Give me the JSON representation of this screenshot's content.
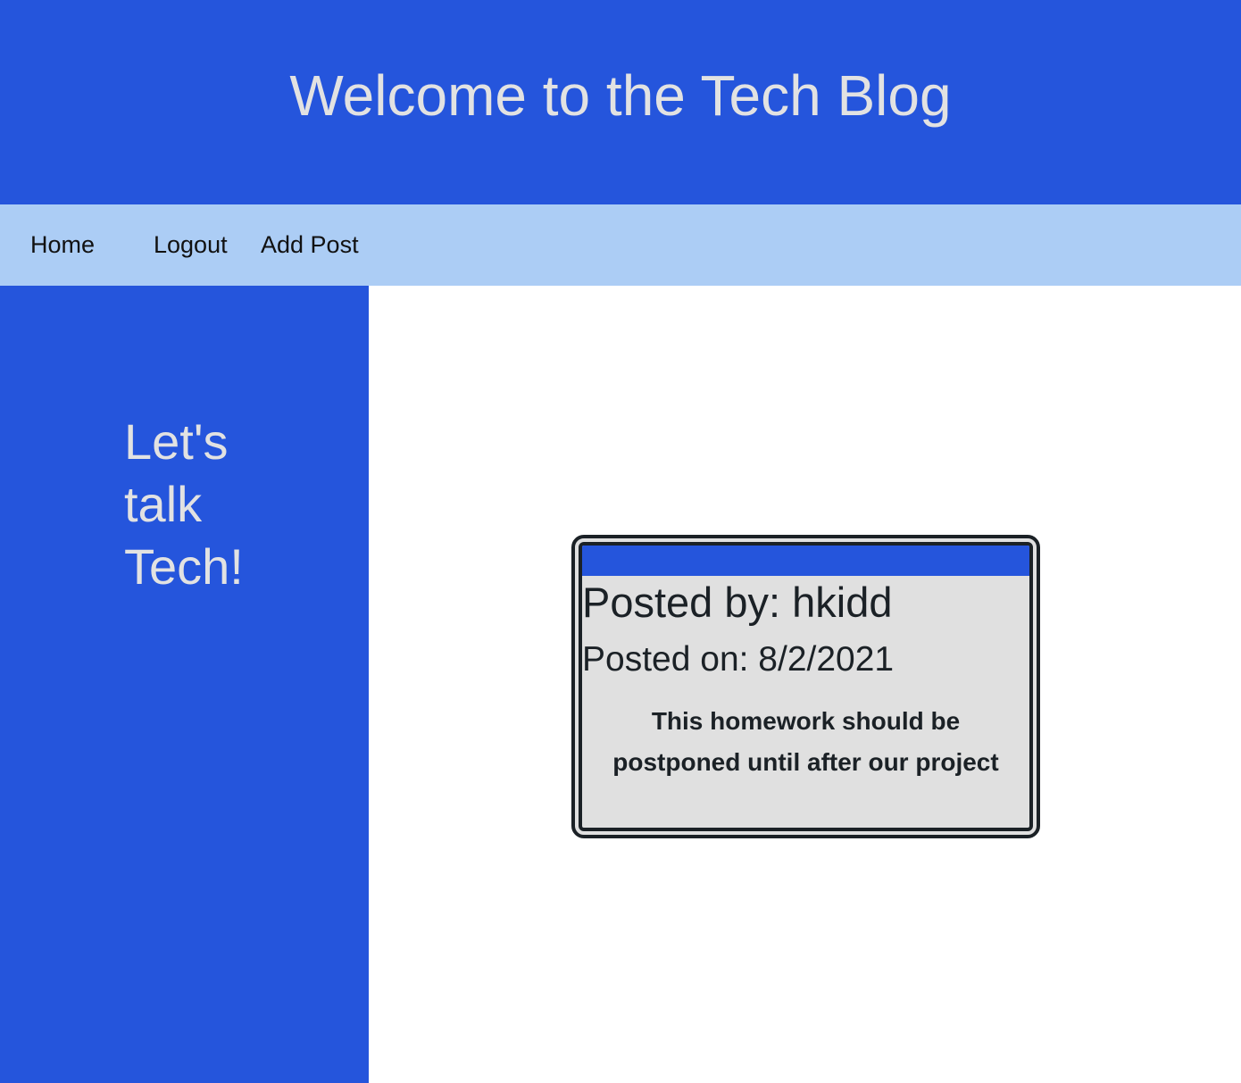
{
  "header": {
    "title": "Welcome to the Tech Blog"
  },
  "nav": {
    "items": [
      {
        "label": "Home"
      },
      {
        "label": "Logout"
      },
      {
        "label": "Add Post"
      }
    ]
  },
  "sidebar": {
    "tagline": "Let's talk Tech!"
  },
  "post": {
    "author_line": "Posted by: hkidd",
    "date_line": "Posted on: 8/2/2021",
    "content": "This homework should be postponed until after our project"
  },
  "colors": {
    "primary_blue": "#2555dc",
    "nav_light_blue": "#accdf5",
    "text_light": "#e2e2e2",
    "card_bg": "#e0e0e0",
    "card_border": "#1b2126"
  }
}
